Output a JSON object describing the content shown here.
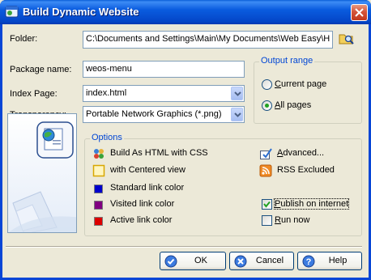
{
  "window": {
    "title": "Build Dynamic Website",
    "close_label": "close"
  },
  "folder": {
    "label": "Folder:",
    "value": "C:\\Documents and Settings\\Main\\My Documents\\Web Easy\\H"
  },
  "package": {
    "label": "Package name:",
    "value": "weos-menu"
  },
  "index_page": {
    "label": "Index Page:",
    "value": "index.html"
  },
  "transparency": {
    "label": "Transparency:",
    "value": "Portable Network Graphics (*.png)"
  },
  "output_range": {
    "title": "Output range",
    "current_page": {
      "label": "Current page",
      "accel": "C",
      "rest": "urrent page",
      "selected": false
    },
    "all_pages": {
      "label": "All pages",
      "accel": "A",
      "rest": "ll pages",
      "selected": true
    }
  },
  "options": {
    "title": "Options",
    "build_html_css": "Build As HTML with CSS",
    "centered_view": "with Centered view",
    "standard_link": {
      "label": "Standard link color",
      "color": "#0000cc"
    },
    "visited_link": {
      "label": "Visited link color",
      "color": "#800080"
    },
    "active_link": {
      "label": "Active link color",
      "color": "#dd0000"
    },
    "advanced": {
      "label": "Advanced...",
      "accel": "A",
      "rest": "dvanced..."
    },
    "rss_excluded": "RSS Excluded",
    "publish_internet": {
      "label": "Publish on internet",
      "accel": "P",
      "rest": "ublish on internet",
      "checked": true
    },
    "run_now": {
      "label": "Run now",
      "accel": "R",
      "rest": "un now",
      "checked": false
    }
  },
  "buttons": {
    "ok": "OK",
    "cancel": "Cancel",
    "help": "Help"
  },
  "colors": {
    "title_bar": "#0a5cdf",
    "group_title": "#0046d5",
    "face": "#ece9d8"
  }
}
